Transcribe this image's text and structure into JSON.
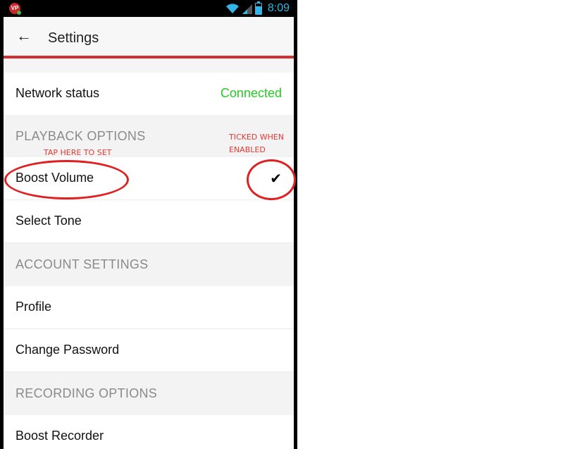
{
  "statusbar": {
    "app_badge": "VP",
    "time": "8:09",
    "accent": "#33b5e5"
  },
  "toolbar": {
    "back_icon": "arrow-left-icon",
    "title": "Settings"
  },
  "rows": {
    "network": {
      "label": "Network status",
      "value": "Connected"
    },
    "boost_volume": {
      "label": "Boost Volume",
      "checked": true
    },
    "select_tone": {
      "label": "Select Tone"
    },
    "profile": {
      "label": "Profile"
    },
    "change_password": {
      "label": "Change Password"
    },
    "boost_recorder": {
      "label": "Boost Recorder"
    }
  },
  "sections": {
    "playback": "PLAYBACK OPTIONS",
    "account": "ACCOUNT SETTINGS",
    "recording": "RECORDING OPTIONS"
  },
  "annotations": {
    "tap_here": "TAP HERE TO SET",
    "ticked_line1": "TICKED WHEN",
    "ticked_line2": "ENABLED"
  },
  "colors": {
    "accent_red": "#d32f2f",
    "connected_green": "#22cc22",
    "annotation_red": "#e53935"
  }
}
